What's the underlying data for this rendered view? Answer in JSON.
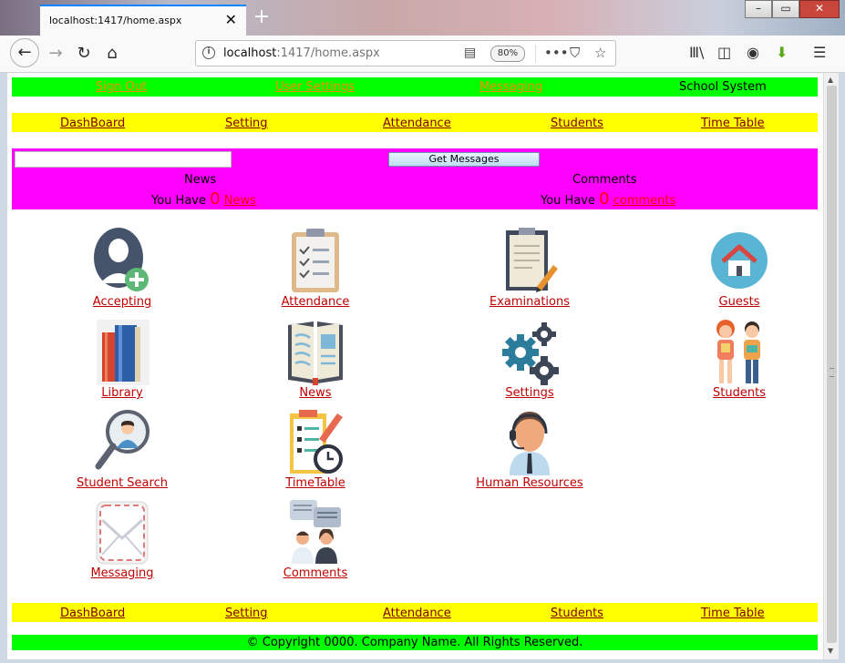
{
  "browser": {
    "tab_title": "localhost:1417/home.aspx",
    "url_host": "localhost",
    "url_rest": ":1417/home.aspx",
    "zoom": "80%"
  },
  "topnav": {
    "sign_out": "Sign Out",
    "user_settings": "User Settings",
    "messaging": "Messaging",
    "brand": "School System"
  },
  "menu": {
    "items": [
      "DashBoard",
      "Setting",
      "Attendance",
      "Students",
      "Time Table"
    ]
  },
  "messages": {
    "button": "Get Messages",
    "news_title": "News",
    "comments_title": "Comments",
    "you_have": "You Have",
    "news_count": "0",
    "news_link": "News",
    "comments_count": "0",
    "comments_link": "comments"
  },
  "tiles": [
    {
      "label": "Accepting",
      "icon": "add-user-icon"
    },
    {
      "label": "Attendance",
      "icon": "clipboard-checklist-icon"
    },
    {
      "label": "Examinations",
      "icon": "exam-clipboard-icon"
    },
    {
      "label": "Guests",
      "icon": "home-icon"
    },
    {
      "label": "Library",
      "icon": "books-icon"
    },
    {
      "label": "News",
      "icon": "open-book-icon"
    },
    {
      "label": "Settings",
      "icon": "gears-icon"
    },
    {
      "label": "Students",
      "icon": "students-icon"
    },
    {
      "label": "Student Search",
      "icon": "search-person-icon"
    },
    {
      "label": "TimeTable",
      "icon": "timetable-icon"
    },
    {
      "label": "Human Resources",
      "icon": "support-agent-icon"
    },
    {
      "label": "Messaging",
      "icon": "envelope-icon"
    },
    {
      "label": "Comments",
      "icon": "comments-people-icon"
    }
  ],
  "footer": {
    "copyright": "© Copyright 0000. Company Name. All Rights Reserved."
  },
  "colors": {
    "top_bar": "#00ff00",
    "menu_bar": "#ffff00",
    "message_panel": "#ff00ff",
    "link_red": "#c00000"
  }
}
